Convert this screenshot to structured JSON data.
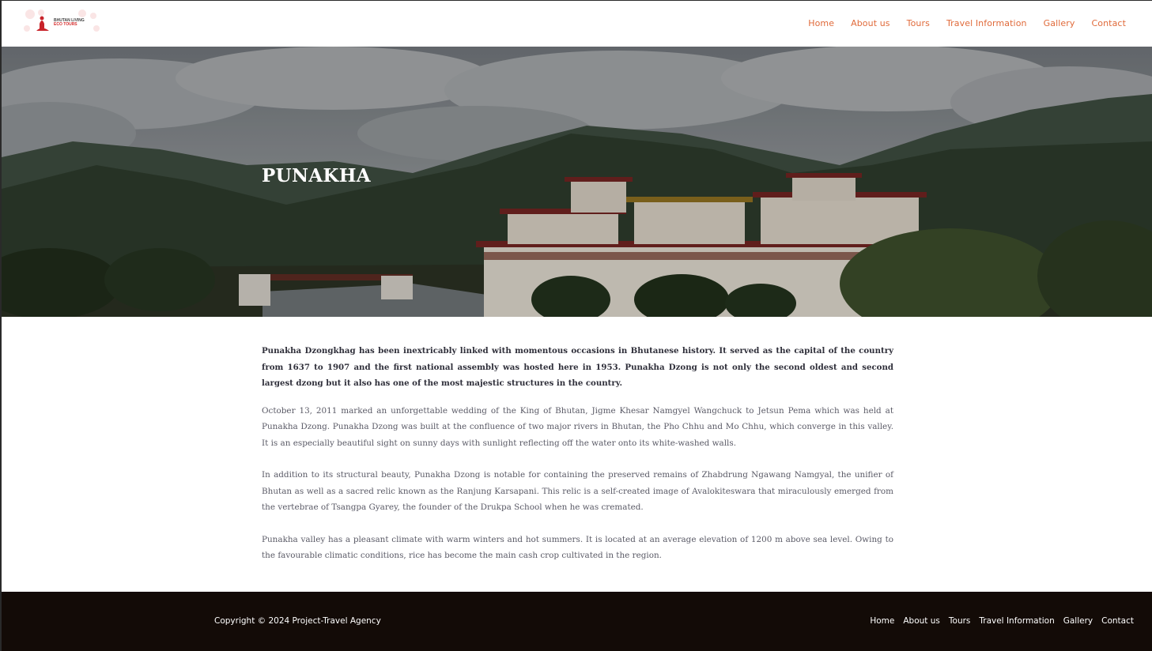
{
  "header": {
    "logo_line1": "BHUTAN LIVING",
    "logo_line2": "ECO TOURS",
    "nav": [
      "Home",
      "About us",
      "Tours",
      "Travel Information",
      "Gallery",
      "Contact"
    ]
  },
  "hero": {
    "title": "PUNAKHA"
  },
  "content": {
    "lead": "Punakha Dzongkhag has been inextricably linked with momentous occasions in Bhutanese history. It served as the capital of the country from 1637 to 1907 and the first national assembly was hosted here in 1953. Punakha Dzong is not only the second oldest and second largest dzong but it also has one of the most majestic structures in the country.",
    "p2": "October 13, 2011 marked an unforgettable wedding of the King of Bhutan, Jigme Khesar Namgyel Wangchuck to Jetsun Pema which was held at Punakha Dzong. Punakha Dzong was built at the confluence of two major rivers in Bhutan, the Pho Chhu and Mo Chhu, which converge in this valley. It is an especially beautiful sight on sunny days with sunlight reflecting off the water onto its white-washed walls.",
    "p3": "In addition to its structural beauty, Punakha Dzong is notable for containing the preserved remains of Zhabdrung Ngawang Namgyal, the unifier of Bhutan as well as a sacred relic known as the Ranjung Karsapani. This relic is a self-created image of Avalokiteswara that miraculously emerged from the vertebrae of Tsangpa Gyarey, the founder of the Drukpa School when he was cremated.",
    "p4": "Punakha valley has a pleasant climate with warm winters and hot summers. It is located at an average elevation of 1200 m above sea level. Owing to the favourable climatic conditions, rice has become the main cash crop cultivated in the region."
  },
  "footer": {
    "copyright": "Copyright © 2024 Project-Travel Agency",
    "nav": [
      "Home",
      "About us",
      "Tours",
      "Travel Information",
      "Gallery",
      "Contact"
    ]
  },
  "colors": {
    "nav_accent": "#e06a3a",
    "footer_bg": "#130b07",
    "logo_red": "#d32a2a"
  }
}
